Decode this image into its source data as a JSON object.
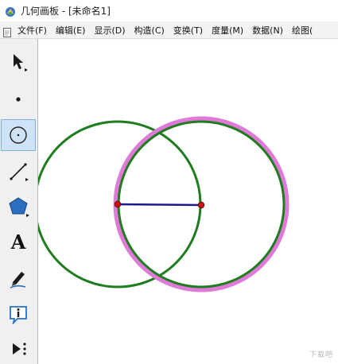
{
  "window": {
    "title": "几何画板 - [未命名1]"
  },
  "menubar": {
    "items": [
      {
        "label": "文件(F)"
      },
      {
        "label": "编辑(E)"
      },
      {
        "label": "显示(D)"
      },
      {
        "label": "构造(C)"
      },
      {
        "label": "变换(T)"
      },
      {
        "label": "度量(M)"
      },
      {
        "label": "数据(N)"
      },
      {
        "label": "绘图("
      }
    ]
  },
  "toolbox": {
    "tools": [
      {
        "name": "arrow-select-tool",
        "icon": "arrow-icon",
        "selected": false
      },
      {
        "name": "point-tool",
        "icon": "point-icon",
        "selected": false
      },
      {
        "name": "compass-tool",
        "icon": "circle-icon",
        "selected": true
      },
      {
        "name": "straightedge-tool",
        "icon": "segment-icon",
        "selected": false
      },
      {
        "name": "polygon-tool",
        "icon": "polygon-icon",
        "selected": false
      },
      {
        "name": "text-tool",
        "icon": "text-icon",
        "label": "A",
        "selected": false
      },
      {
        "name": "marker-tool",
        "icon": "pen-icon",
        "selected": false
      },
      {
        "name": "information-tool",
        "icon": "info-icon",
        "selected": false
      },
      {
        "name": "custom-tool",
        "icon": "custom-play-icon",
        "selected": false
      }
    ]
  },
  "canvas": {
    "colors": {
      "circle": "#1f7d1f",
      "selection_halo": "#e07ad8",
      "segment": "#1a1a8c",
      "point": "#cc1111"
    }
  },
  "watermark": {
    "text": "下载吧"
  }
}
